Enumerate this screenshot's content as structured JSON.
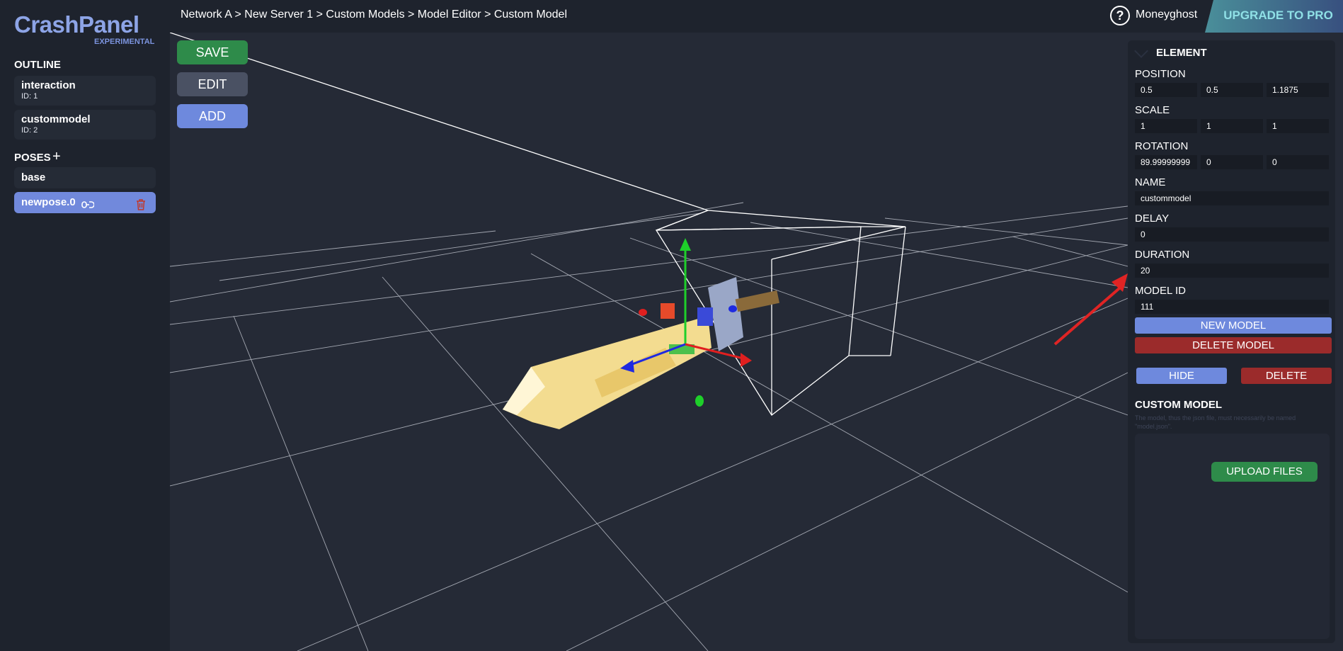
{
  "app": {
    "logo": "CrashPanel",
    "logo_tag": "EXPERIMENTAL"
  },
  "topbar": {
    "breadcrumb": "Network A > New Server 1 > Custom Models > Model Editor > Custom Model",
    "username": "Moneyghost",
    "help_icon": "?",
    "upgrade_label": "UPGRADE TO PRO"
  },
  "sidebar": {
    "outline_title": "OUTLINE",
    "outline_items": [
      {
        "name": "interaction",
        "id": "ID: 1"
      },
      {
        "name": "custommodel",
        "id": "ID: 2"
      }
    ],
    "poses_title": "POSES",
    "poses_add": "+",
    "poses": [
      {
        "name": "base",
        "active": false
      },
      {
        "name": "newpose.0",
        "active": true
      }
    ]
  },
  "toolbar": {
    "save_label": "SAVE",
    "edit_label": "EDIT",
    "add_label": "ADD"
  },
  "panel": {
    "title": "ELEMENT",
    "position_label": "POSITION",
    "position": [
      "0.5",
      "0.5",
      "1.1875"
    ],
    "scale_label": "SCALE",
    "scale": [
      "1",
      "1",
      "1"
    ],
    "rotation_label": "ROTATION",
    "rotation": [
      "89.99999999",
      "0",
      "0"
    ],
    "name_label": "NAME",
    "name_value": "custommodel",
    "delay_label": "DELAY",
    "delay_value": "0",
    "duration_label": "DURATION",
    "duration_value": "20",
    "model_id_label": "MODEL ID",
    "model_id_value": "111",
    "new_model_label": "NEW MODEL",
    "delete_model_label": "DELETE MODEL",
    "hide_label": "HIDE",
    "delete_label": "DELETE",
    "custom_model_title": "CUSTOM MODEL",
    "custom_model_hint": "The model, thus the json file, must necessarily be named \"model.json\".",
    "upload_label": "UPLOAD FILES"
  },
  "colors": {
    "accent": "#7189dc",
    "save": "#2e8b4a",
    "edit": "#4a5163",
    "danger": "#9b2b2b",
    "upload": "#2e8b4a"
  },
  "icons": {
    "link": "link-icon",
    "trash": "trash-icon",
    "help": "help-icon",
    "chevron": "chevron-down-icon"
  }
}
